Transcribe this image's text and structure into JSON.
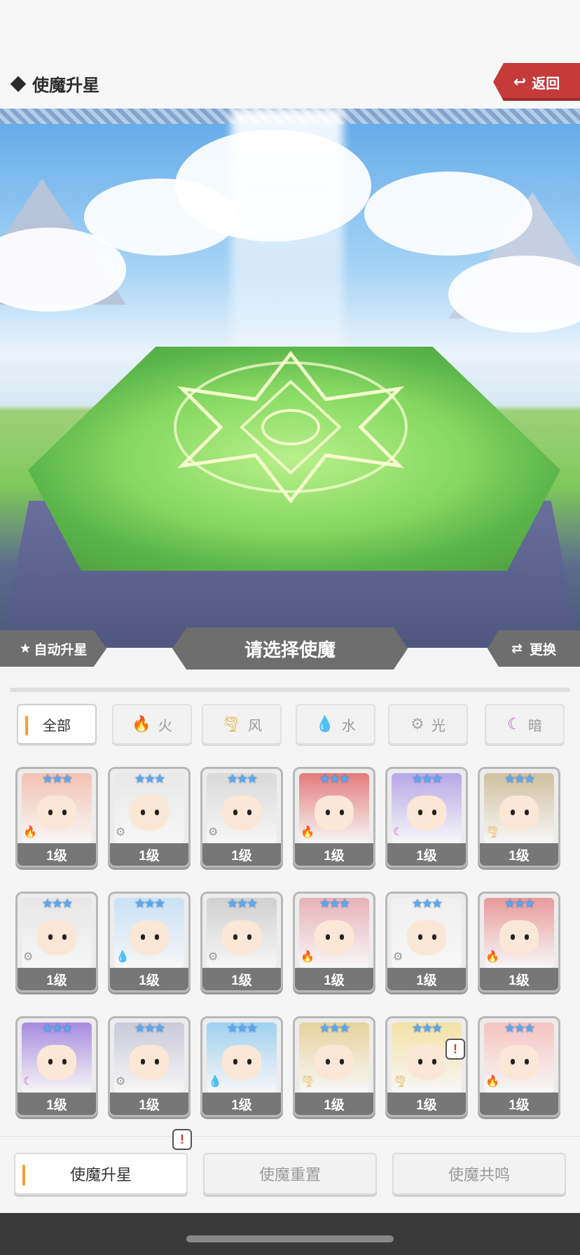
{
  "header": {
    "title": "使魔升星",
    "back_label": "返回"
  },
  "controls": {
    "auto_label": "自动升星",
    "select_label": "请选择使魔",
    "swap_label": "更换"
  },
  "filters": [
    {
      "label": "全部",
      "icon": "",
      "active": true
    },
    {
      "label": "火",
      "icon": "fire-icon",
      "active": false
    },
    {
      "label": "风",
      "icon": "wind-icon",
      "active": false
    },
    {
      "label": "水",
      "icon": "water-icon",
      "active": false
    },
    {
      "label": "光",
      "icon": "light-icon",
      "active": false
    },
    {
      "label": "暗",
      "icon": "dark-icon",
      "active": false
    }
  ],
  "cards": [
    {
      "level": "1级",
      "element": "fire",
      "bg": "#f3c2b3"
    },
    {
      "level": "1级",
      "element": "light",
      "bg": "#e8e8e8"
    },
    {
      "level": "1级",
      "element": "light",
      "bg": "#d9d9d9"
    },
    {
      "level": "1级",
      "element": "fire",
      "bg": "#e37b7b"
    },
    {
      "level": "1级",
      "element": "dark",
      "bg": "#b6a7e6"
    },
    {
      "level": "1级",
      "element": "wind",
      "bg": "#cfc0a0"
    },
    {
      "level": "1级",
      "element": "light",
      "bg": "#e6e6e6"
    },
    {
      "level": "1级",
      "element": "water",
      "bg": "#c9e2f4"
    },
    {
      "level": "1级",
      "element": "light",
      "bg": "#d0d0d0"
    },
    {
      "level": "1级",
      "element": "fire",
      "bg": "#e7b2b8"
    },
    {
      "level": "1级",
      "element": "light",
      "bg": "#f0f0f0"
    },
    {
      "level": "1级",
      "element": "fire",
      "bg": "#e99a9a"
    },
    {
      "level": "1级",
      "element": "dark",
      "bg": "#a78be0"
    },
    {
      "level": "1级",
      "element": "light",
      "bg": "#c9c9d9"
    },
    {
      "level": "1级",
      "element": "water",
      "bg": "#9fd0f0"
    },
    {
      "level": "1级",
      "element": "wind",
      "bg": "#e6d39c"
    },
    {
      "level": "1级",
      "element": "wind",
      "bg": "#f2e2a6"
    },
    {
      "level": "1级",
      "element": "fire",
      "bg": "#f5c3c0"
    }
  ],
  "star_glyphs": "★★★",
  "alert_glyph": "!",
  "bottom_tabs": [
    {
      "label": "使魔升星",
      "active": true
    },
    {
      "label": "使魔重置",
      "active": false
    },
    {
      "label": "使魔共鸣",
      "active": false
    }
  ],
  "colors": {
    "accent": "#f0a033",
    "back_red": "#c63a3a",
    "level_bar": "#777777",
    "star_blue": "#5aa8ee"
  }
}
